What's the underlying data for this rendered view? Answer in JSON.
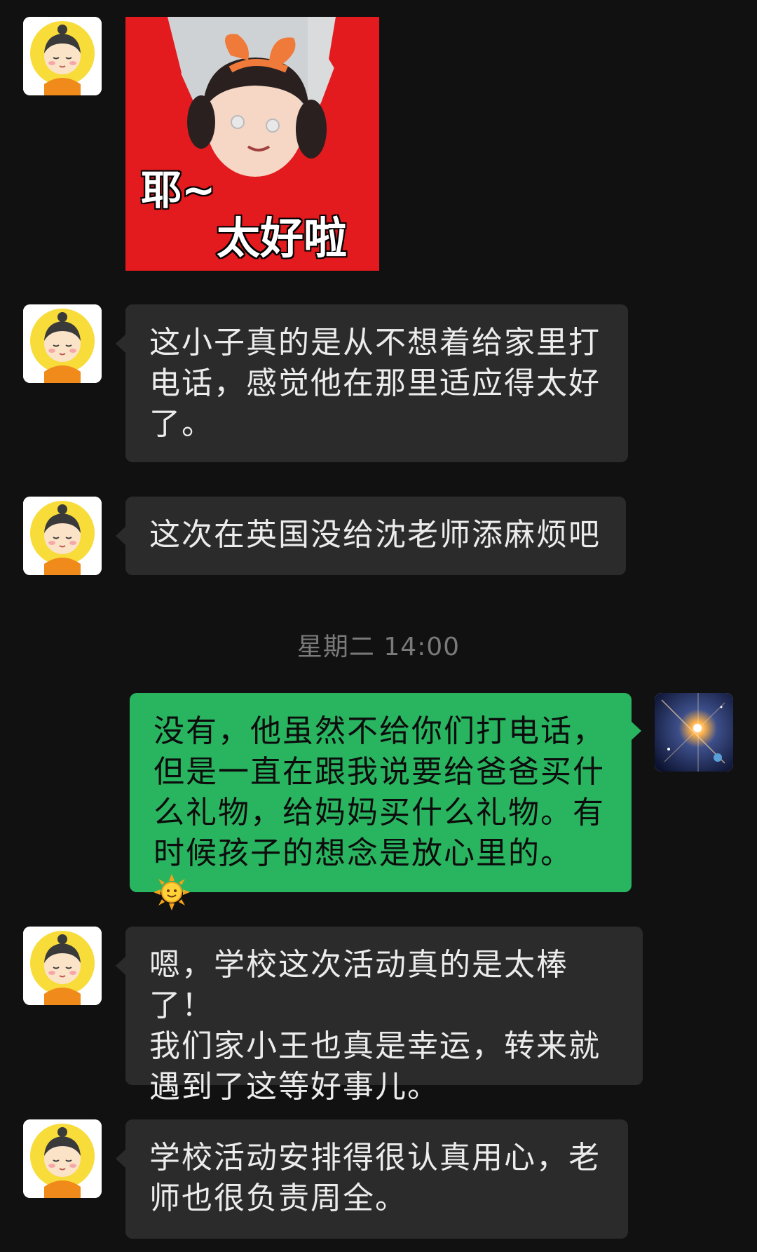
{
  "sticker": {
    "caption_line1": "耶~",
    "caption_line2": "太好啦"
  },
  "messages": [
    {
      "side": "in",
      "text": "这小子真的是从不想着给家里打\n电话，感觉他在那里适应得太好\n了。"
    },
    {
      "side": "in",
      "text": "这次在英国没给沈老师添麻烦吧"
    },
    {
      "side": "out",
      "text": "没有，他虽然不给你们打电话，\n但是一直在跟我说要给爸爸买什\n么礼物，给妈妈买什么礼物。有\n时候孩子的想念是放心里的。",
      "emoji": "sun-emoji"
    },
    {
      "side": "in",
      "text": "嗯，学校这次活动真的是太棒了！\n我们家小王也真是幸运，转来就\n遇到了这等好事儿。"
    },
    {
      "side": "in",
      "text": "学校活动安排得很认真用心，老\n师也很负责周全。"
    }
  ],
  "timestamp": "星期二 14:00",
  "colors": {
    "background": "#111111",
    "incoming_bubble": "#2b2b2b",
    "outgoing_bubble": "#29b460"
  }
}
